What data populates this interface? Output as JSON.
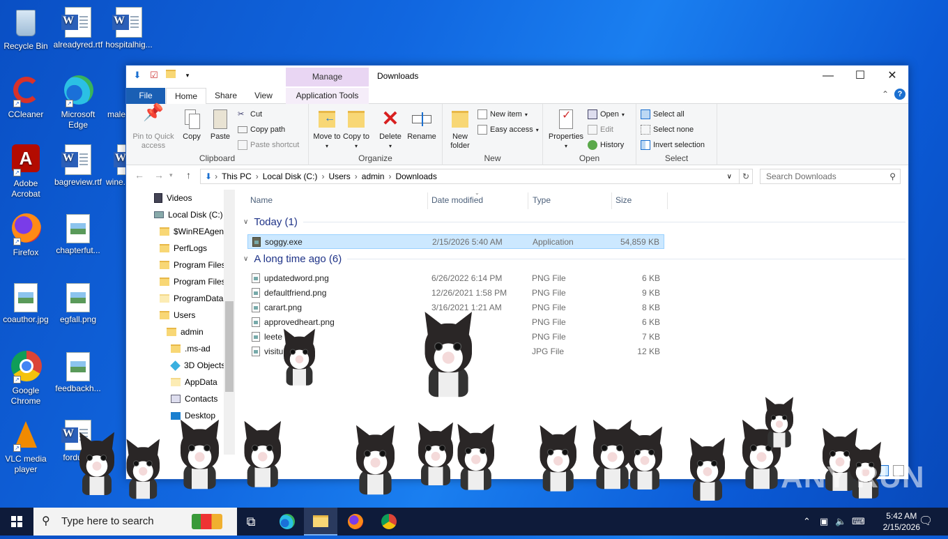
{
  "desktop": {
    "icons": [
      {
        "label": "Recycle Bin"
      },
      {
        "label": "alreadyred.rtf"
      },
      {
        "label": "hospitalhig..."
      },
      {
        "label": "CCleaner"
      },
      {
        "label": "Microsoft Edge"
      },
      {
        "label": "male..."
      },
      {
        "label": "Adobe Acrobat"
      },
      {
        "label": "bagreview.rtf"
      },
      {
        "label": "wine..."
      },
      {
        "label": "Firefox"
      },
      {
        "label": "chapterfut..."
      },
      {
        "label": "coauthor.jpg"
      },
      {
        "label": "egfall.png"
      },
      {
        "label": "Google Chrome"
      },
      {
        "label": "feedbackh..."
      },
      {
        "label": "VLC media player"
      },
      {
        "label": "fordus..."
      }
    ]
  },
  "window": {
    "title": "Downloads",
    "manage_tab": "Manage",
    "tabs": {
      "file": "File",
      "home": "Home",
      "share": "Share",
      "view": "View",
      "app_tools": "Application Tools"
    },
    "ribbon": {
      "clipboard": {
        "label": "Clipboard",
        "pin": "Pin to Quick access",
        "copy": "Copy",
        "paste": "Paste",
        "cut": "Cut",
        "copy_path": "Copy path",
        "paste_shortcut": "Paste shortcut"
      },
      "organize": {
        "label": "Organize",
        "move_to": "Move to",
        "copy_to": "Copy to",
        "delete": "Delete",
        "rename": "Rename"
      },
      "new": {
        "label": "New",
        "new_folder": "New folder",
        "new_item": "New item",
        "easy_access": "Easy access"
      },
      "open": {
        "label": "Open",
        "properties": "Properties",
        "open": "Open",
        "edit": "Edit",
        "history": "History"
      },
      "select": {
        "label": "Select",
        "select_all": "Select all",
        "select_none": "Select none",
        "invert": "Invert selection"
      }
    },
    "address": {
      "parts": [
        "This PC",
        "Local Disk (C:)",
        "Users",
        "admin",
        "Downloads"
      ]
    },
    "search_placeholder": "Search Downloads",
    "nav": [
      "Videos",
      "Local Disk (C:)",
      "$WinREAgent",
      "PerfLogs",
      "Program Files",
      "Program Files",
      "ProgramData",
      "Users",
      "admin",
      ".ms-ad",
      "3D Objects",
      "AppData",
      "Contacts",
      "Desktop"
    ],
    "columns": {
      "name": "Name",
      "date": "Date modified",
      "type": "Type",
      "size": "Size"
    },
    "groups": [
      {
        "title": "Today (1)",
        "files": [
          {
            "name": "soggy.exe",
            "date": "2/15/2026 5:40 AM",
            "type": "Application",
            "size": "54,859 KB"
          }
        ]
      },
      {
        "title": "A long time ago (6)",
        "files": [
          {
            "name": "updatedword.png",
            "date": "6/26/2022 6:14 PM",
            "type": "PNG File",
            "size": "6 KB"
          },
          {
            "name": "defaultfriend.png",
            "date": "12/26/2021 1:58 PM",
            "type": "PNG File",
            "size": "9 KB"
          },
          {
            "name": "carart.png",
            "date": "3/16/2021 1:21 AM",
            "type": "PNG File",
            "size": "8 KB"
          },
          {
            "name": "approvedheart.png",
            "date": "",
            "type": "PNG File",
            "size": "6 KB"
          },
          {
            "name": "leete",
            "date": "35 AM",
            "type": "PNG File",
            "size": "7 KB"
          },
          {
            "name": "visitur",
            "date": "5 PM",
            "type": "JPG File",
            "size": "12 KB"
          }
        ]
      }
    ]
  },
  "taskbar": {
    "search_placeholder": "Type here to search",
    "time": "5:42 AM",
    "date": "2/15/2026"
  },
  "watermark": "ANY RUN"
}
